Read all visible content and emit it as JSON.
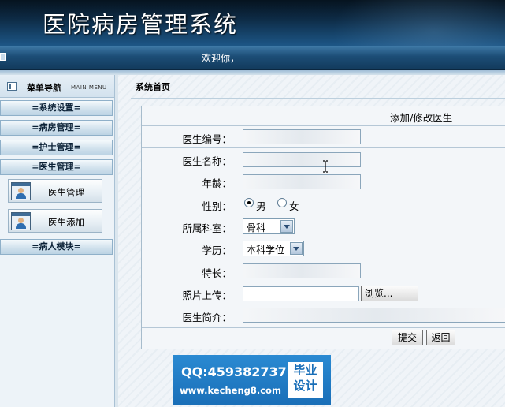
{
  "app": {
    "title": "医院病房管理系统"
  },
  "welcome": {
    "text": "欢迎你，"
  },
  "sidebar": {
    "title": "菜单导航",
    "subtitle": "MAIN MENU",
    "menus": [
      {
        "label": "=系统设置="
      },
      {
        "label": "=病房管理="
      },
      {
        "label": "=护士管理="
      },
      {
        "label": "=医生管理="
      },
      {
        "label": "=病人模块="
      }
    ],
    "submenu": [
      {
        "label": "医生管理",
        "icon": "doctor-icon"
      },
      {
        "label": "医生添加",
        "icon": "doctor-icon"
      }
    ]
  },
  "main": {
    "breadcrumb": "系统首页",
    "form": {
      "title": "添加/修改医生",
      "fields": {
        "doctor_id": {
          "label": "医生编号：",
          "value": ""
        },
        "doctor_name": {
          "label": "医生名称：",
          "value": ""
        },
        "age": {
          "label": "年龄：",
          "value": ""
        },
        "gender": {
          "label": "性别：",
          "options": [
            "男",
            "女"
          ],
          "selected": "男"
        },
        "department": {
          "label": "所属科室：",
          "value": "骨科"
        },
        "education": {
          "label": "学历：",
          "value": "本科学位"
        },
        "specialty": {
          "label": "特长：",
          "value": ""
        },
        "photo": {
          "label": "照片上传：",
          "value": "",
          "browse_label": "浏览..."
        },
        "intro": {
          "label": "医生简介：",
          "value": ""
        }
      },
      "submit_label": "提交",
      "back_label": "返回"
    }
  },
  "watermark": {
    "qq": "QQ:459382737",
    "url": "www.kecheng8.com",
    "badge_line1": "毕业",
    "badge_line2": "设计"
  }
}
